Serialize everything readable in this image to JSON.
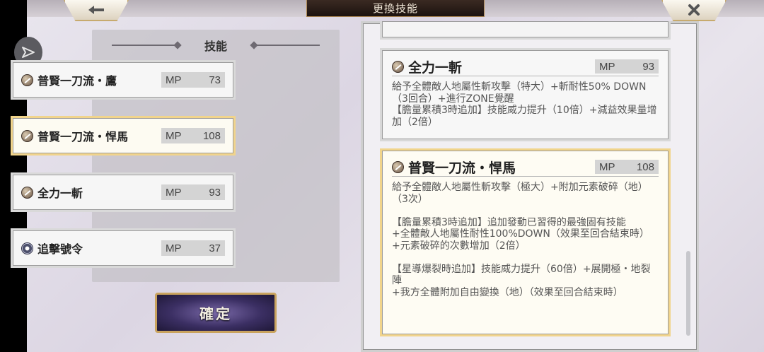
{
  "header": {
    "title": "更換技能",
    "back_icon": "back-arrow-icon",
    "close_icon": "close-icon"
  },
  "skill_list": {
    "title": "技能",
    "mp_label": "MP",
    "items": [
      {
        "name": "普賢一刀流・鷹",
        "mp": "73",
        "icon": "sword-skill-icon",
        "selected": false
      },
      {
        "name": "普賢一刀流・悍馬",
        "mp": "108",
        "icon": "sword-skill-icon",
        "selected": true
      },
      {
        "name": "全力一斬",
        "mp": "93",
        "icon": "sword-skill-icon",
        "selected": false
      },
      {
        "name": "追擊號令",
        "mp": "37",
        "icon": "command-skill-icon",
        "selected": false
      }
    ]
  },
  "confirm_label": "確定",
  "details": {
    "cards": [
      {
        "name": "全力一斬",
        "mp": "93",
        "description": "給予全體敵人地屬性斬攻擊（特大）+斬耐性50% DOWN（3回合）+進行ZONE覺醒\n【膽量累積3時追加】技能威力提升（10倍）+減益效果量增加（2倍）"
      },
      {
        "name": "普賢一刀流・悍馬",
        "mp": "108",
        "description": "給予全體敵人地屬性斬攻擊（極大）+附加元素破碎（地）（3次）\n\n【膽量累積3時追加】追加發動已習得的最強固有技能\n+全體敵人地屬性耐性100%DOWN（效果至回合結束時）+元素破碎的次數增加（2倍）\n\n【星導爆裂時追加】技能威力提升（60倍）+展開極・地裂陣\n+我方全體附加自由變換（地）（效果至回合結束時）"
      }
    ]
  }
}
